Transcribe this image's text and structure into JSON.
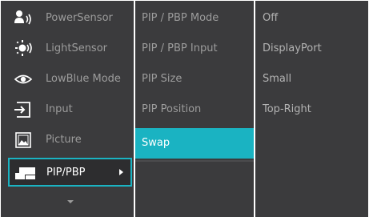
{
  "main_menu": {
    "items": [
      {
        "label": "PowerSensor",
        "icon": "power-sensor-icon"
      },
      {
        "label": "LightSensor",
        "icon": "light-sensor-icon"
      },
      {
        "label": "LowBlue Mode",
        "icon": "eye-icon"
      },
      {
        "label": "Input",
        "icon": "input-icon"
      },
      {
        "label": "Picture",
        "icon": "picture-icon"
      },
      {
        "label": "PIP/PBP",
        "icon": "pip-icon",
        "active": true
      }
    ],
    "scroll_icon": "chevron-down-icon"
  },
  "sub_menu": {
    "items": [
      {
        "label": "PIP / PBP Mode"
      },
      {
        "label": "PIP / PBP Input"
      },
      {
        "label": "PIP Size"
      },
      {
        "label": "PIP Position"
      },
      {
        "label": "Swap",
        "selected": true
      }
    ]
  },
  "options": {
    "items": [
      {
        "label": "Off"
      },
      {
        "label": "DisplayPort"
      },
      {
        "label": "Small"
      },
      {
        "label": "Top-Right"
      }
    ]
  },
  "colors": {
    "panel": "#3b3b3d",
    "accent": "#1ab3c2",
    "text_inactive": "#9c9c9c",
    "text_active": "#ffffff"
  }
}
